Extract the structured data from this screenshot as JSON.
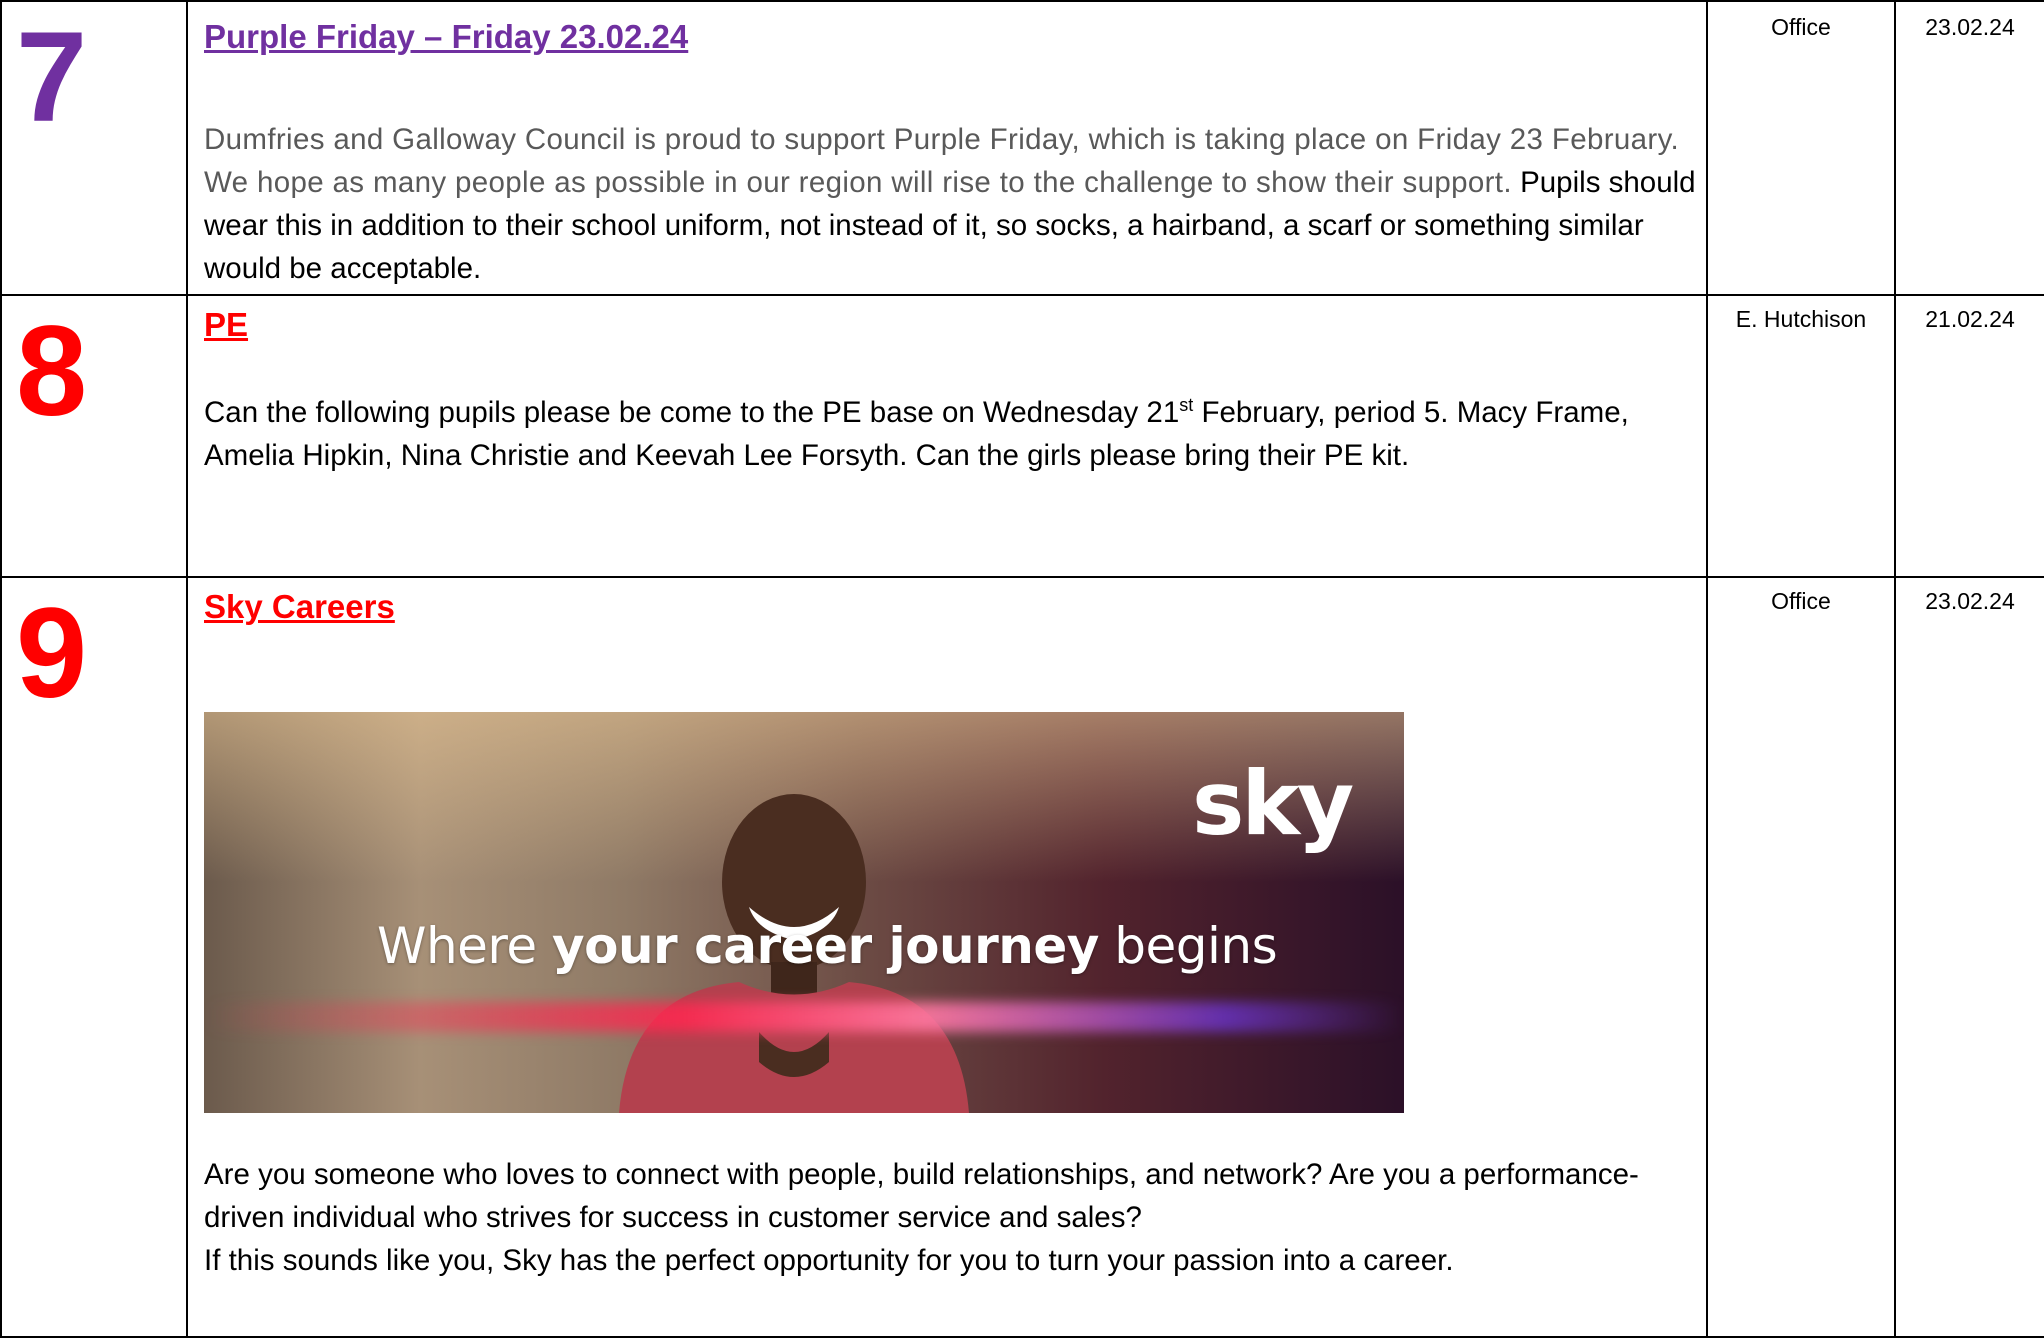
{
  "items": [
    {
      "number": "7",
      "heading": "Purple Friday – Friday 23.02.24",
      "text_grey": "Dumfries and Galloway Council is proud to support Purple Friday, which is taking place on Friday 23 February. We hope as many people as possible in our region will rise to the challenge to show their support.",
      "text_black": " Pupils should wear this in addition to their school uniform, not instead of it, so socks, a hairband, a scarf or something similar would be acceptable.",
      "from": "Office",
      "date": "23.02.24"
    },
    {
      "number": "8",
      "heading": "PE",
      "text_before_sup": "Can the following pupils please be come to the PE base on Wednesday 21",
      "sup": "st",
      "text_after_sup": " February, period 5. Macy Frame, Amelia Hipkin, Nina Christie and Keevah Lee Forsyth. Can the girls please bring their PE kit.",
      "from": "E. Hutchison",
      "date": "21.02.24"
    },
    {
      "number": "9",
      "heading": "Sky Careers",
      "banner": {
        "logo": "sky",
        "tag_start": "Where ",
        "tag_bold": "your career journey",
        "tag_end": " begins"
      },
      "para1": " Are you someone who loves to connect with people, build relationships, and network? Are you a performance-driven individual who strives for success in customer service and sales?",
      "para2": "If this sounds like you, Sky has the perfect opportunity for you to turn your passion into a career.",
      "from": "Office",
      "date": "23.02.24"
    }
  ],
  "colors": {
    "purple": "#7030a0",
    "red": "#ff0000",
    "grey_text": "#595959"
  }
}
